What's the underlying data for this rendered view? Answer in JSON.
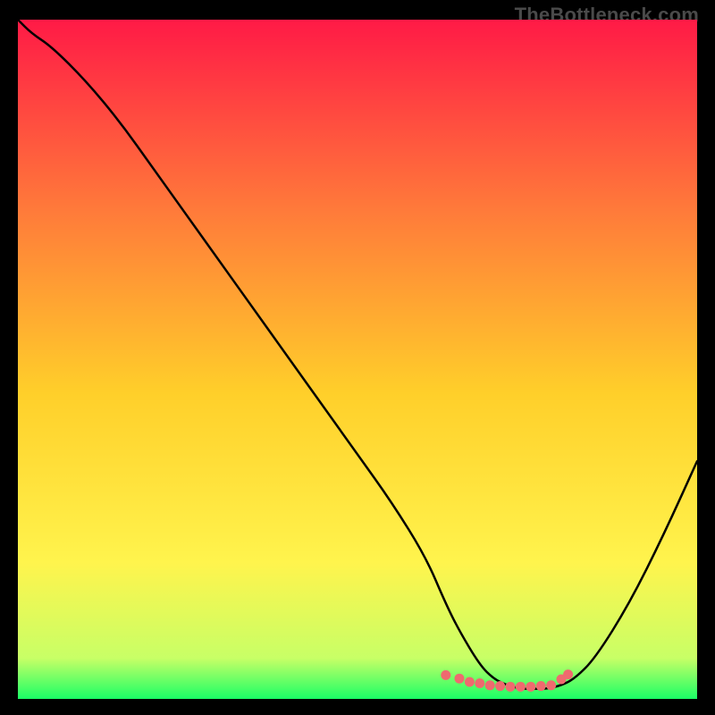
{
  "watermark": "TheBottleneck.com",
  "chart_data": {
    "type": "line",
    "title": "",
    "xlabel": "",
    "ylabel": "",
    "xlim": [
      0,
      100
    ],
    "ylim": [
      0,
      100
    ],
    "grid": false,
    "legend": false,
    "background_gradient": {
      "top": "#ff1a46",
      "mid_upper": "#ff7a3a",
      "mid": "#ffcf2a",
      "mid_lower": "#fff44d",
      "near_bottom": "#c8ff66",
      "bottom": "#1aff66"
    },
    "x": [
      0,
      2,
      5,
      10,
      15,
      20,
      25,
      30,
      35,
      40,
      45,
      50,
      55,
      60,
      63,
      65,
      68,
      70,
      72,
      74,
      76,
      78,
      80,
      82,
      85,
      90,
      95,
      100
    ],
    "series": [
      {
        "name": "bottleneck-curve",
        "color": "#000000",
        "values": [
          100,
          98,
          96,
          91,
          85,
          78,
          71,
          64,
          57,
          50,
          43,
          36,
          29,
          21,
          14,
          10,
          5,
          3,
          2,
          1.5,
          1.5,
          1.5,
          2,
          3,
          6,
          14,
          24,
          35
        ]
      }
    ],
    "markers": {
      "color": "#ef6a6f",
      "points": [
        {
          "x": 63,
          "y": 3.5
        },
        {
          "x": 65,
          "y": 3.0
        },
        {
          "x": 66.5,
          "y": 2.5
        },
        {
          "x": 68,
          "y": 2.3
        },
        {
          "x": 69.5,
          "y": 2.0
        },
        {
          "x": 71,
          "y": 1.9
        },
        {
          "x": 72.5,
          "y": 1.8
        },
        {
          "x": 74,
          "y": 1.8
        },
        {
          "x": 75.5,
          "y": 1.8
        },
        {
          "x": 77,
          "y": 1.9
        },
        {
          "x": 78.5,
          "y": 2.0
        },
        {
          "x": 80,
          "y": 2.9
        },
        {
          "x": 81,
          "y": 3.6
        }
      ]
    }
  }
}
